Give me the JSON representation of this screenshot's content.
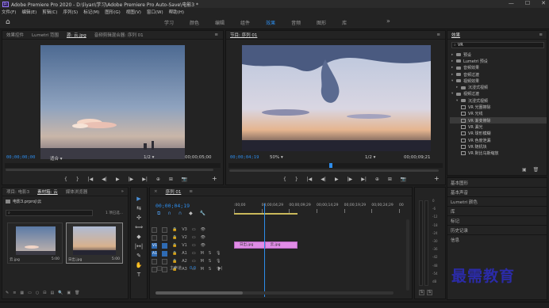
{
  "app": {
    "title": "Adobe Premiere Pro 2020 - D:\\liyan\\学习\\Adobe Premiere Pro Auto-Save\\电影3 *",
    "logo_text": "Pr"
  },
  "window_controls": [
    "—",
    "☐",
    "✕"
  ],
  "menu": [
    "文件(F)",
    "编辑(E)",
    "剪辑(C)",
    "序列(S)",
    "标记(M)",
    "图形(G)",
    "视图(V)",
    "窗口(W)",
    "帮助(H)"
  ],
  "workspaces": [
    {
      "label": "学习",
      "active": false
    },
    {
      "label": "颜色",
      "active": false
    },
    {
      "label": "编辑",
      "active": false
    },
    {
      "label": "组件",
      "active": false
    },
    {
      "label": "效果",
      "active": true
    },
    {
      "label": "音频",
      "active": false
    },
    {
      "label": "图形",
      "active": false
    },
    {
      "label": "库",
      "active": false
    }
  ],
  "workspace_more": "»",
  "source_monitor": {
    "tabs": [
      "效果控件",
      "Lumetri 范围",
      "源: 云.jpg",
      "音频剪辑混合器: 序列 01"
    ],
    "active_tab_index": 2,
    "timecode_in": "00;00;00;00",
    "fit": "适合",
    "scale": "1/2",
    "timecode_out": "00;00;05;00"
  },
  "program_monitor": {
    "title": "节目: 序列 01",
    "timecode_in": "00;00;04;19",
    "fit": "50%",
    "scale": "1/2",
    "timecode_out": "00;00;09;21",
    "playhead_fraction": 0.47
  },
  "transport_icons": [
    "mark-in",
    "mark-out",
    "go-to-in",
    "step-back",
    "play",
    "step-forward",
    "go-to-out",
    "insert",
    "overwrite",
    "export-frame"
  ],
  "transport_glyphs": [
    "{",
    "}",
    "|◀",
    "◀|",
    "▶",
    "|▶",
    "▶|",
    "⊕",
    "⊞",
    "📷"
  ],
  "effects": {
    "title": "效果",
    "menu_glyph": "≡",
    "search_value": "VR",
    "tree": [
      {
        "indent": 0,
        "type": "fold",
        "label": "预设",
        "open": false
      },
      {
        "indent": 0,
        "type": "fold",
        "label": "Lumetri 预设",
        "open": false
      },
      {
        "indent": 0,
        "type": "fold",
        "label": "音频效果",
        "open": false
      },
      {
        "indent": 0,
        "type": "fold",
        "label": "音频过渡",
        "open": false
      },
      {
        "indent": 0,
        "type": "fold",
        "label": "视频效果",
        "open": true
      },
      {
        "indent": 1,
        "type": "fold",
        "label": "沉浸式视频",
        "open": false
      },
      {
        "indent": 0,
        "type": "fold",
        "label": "视频过渡",
        "open": true
      },
      {
        "indent": 1,
        "type": "fold",
        "label": "沉浸式视频",
        "open": true
      },
      {
        "indent": 2,
        "type": "fx",
        "label": "VR 光圈擦除",
        "selected": false
      },
      {
        "indent": 2,
        "type": "fx",
        "label": "VR 光线",
        "selected": false
      },
      {
        "indent": 2,
        "type": "fx",
        "label": "VR 渐变擦除",
        "selected": true
      },
      {
        "indent": 2,
        "type": "fx",
        "label": "VR 漏光",
        "selected": false
      },
      {
        "indent": 2,
        "type": "fx",
        "label": "VR 球形模糊",
        "selected": false
      },
      {
        "indent": 2,
        "type": "fx",
        "label": "VR 色度泄漏",
        "selected": false
      },
      {
        "indent": 2,
        "type": "fx",
        "label": "VR 随机块",
        "selected": false
      },
      {
        "indent": 2,
        "type": "fx",
        "label": "VR 默比乌斯缩放",
        "selected": false
      }
    ],
    "footer_icons": [
      "new-bin",
      "delete"
    ],
    "footer_glyphs": [
      "▣",
      "🗑"
    ]
  },
  "side_panels": [
    "基本图形",
    "基本声音",
    "Lumetri 颜色",
    "库",
    "标记",
    "历史记录",
    "信息"
  ],
  "project": {
    "tabs": [
      "项目: 电影3",
      "素材箱: 云",
      "媒体浏览器"
    ],
    "active_tab_index": 1,
    "overflow": "»",
    "path": "电影3.prproj\\云",
    "count": "1 项已选...",
    "items": [
      {
        "name": "云.jpg",
        "duration": "5:00"
      },
      {
        "name": "日出.jpg",
        "duration": "5:00"
      }
    ],
    "footer_glyphs": [
      "✎",
      "≡",
      "▦",
      "▭",
      "○",
      "⊟",
      "▤",
      "🔍",
      "▣",
      "🗑"
    ]
  },
  "tools": [
    "▶",
    "⇆",
    "✣",
    "⟺",
    "◆",
    "|↔|",
    "✎",
    "✋",
    "T"
  ],
  "timeline": {
    "tab": "序列 01",
    "timecode": "00;00;04;19",
    "ruler": [
      ":00;00",
      "00;00;04;29",
      "00;00;09;29",
      "00;00;14;29",
      "00;00;19;29",
      "00;00;24;29",
      "00"
    ],
    "tracks": [
      {
        "name": "V3",
        "kind": "video"
      },
      {
        "name": "V2",
        "kind": "video"
      },
      {
        "name": "V1",
        "kind": "video"
      },
      {
        "name": "A1",
        "kind": "audio",
        "M": "M",
        "S": "S"
      },
      {
        "name": "A2",
        "kind": "audio",
        "M": "M",
        "S": "S"
      },
      {
        "name": "A3",
        "kind": "audio",
        "M": "M",
        "S": "S"
      }
    ],
    "source_patch": {
      "video": "V1",
      "audio": "A1"
    },
    "master_label": "主声道",
    "master_value": "0.0",
    "clips": [
      {
        "name": "日出.jpg",
        "start_seconds": 0,
        "end_seconds": 4.67
      },
      {
        "name": "云.jpg",
        "start_seconds": 4.67,
        "end_seconds": 9.67
      }
    ],
    "playhead_seconds": 4.63,
    "visible_seconds": 25.9
  },
  "meter_scale": [
    "0",
    "-6",
    "-12",
    "-18",
    "-24",
    "-30",
    "-36",
    "-42",
    "-48",
    "-54",
    "dB"
  ],
  "meter_buttons": [
    "S",
    "S"
  ],
  "watermark": "最需教育",
  "colors": {
    "accent": "#2d8ceb",
    "clip": "#e08ce6",
    "playhead": "#2d8ceb",
    "watermark": "#2b2ba8"
  }
}
